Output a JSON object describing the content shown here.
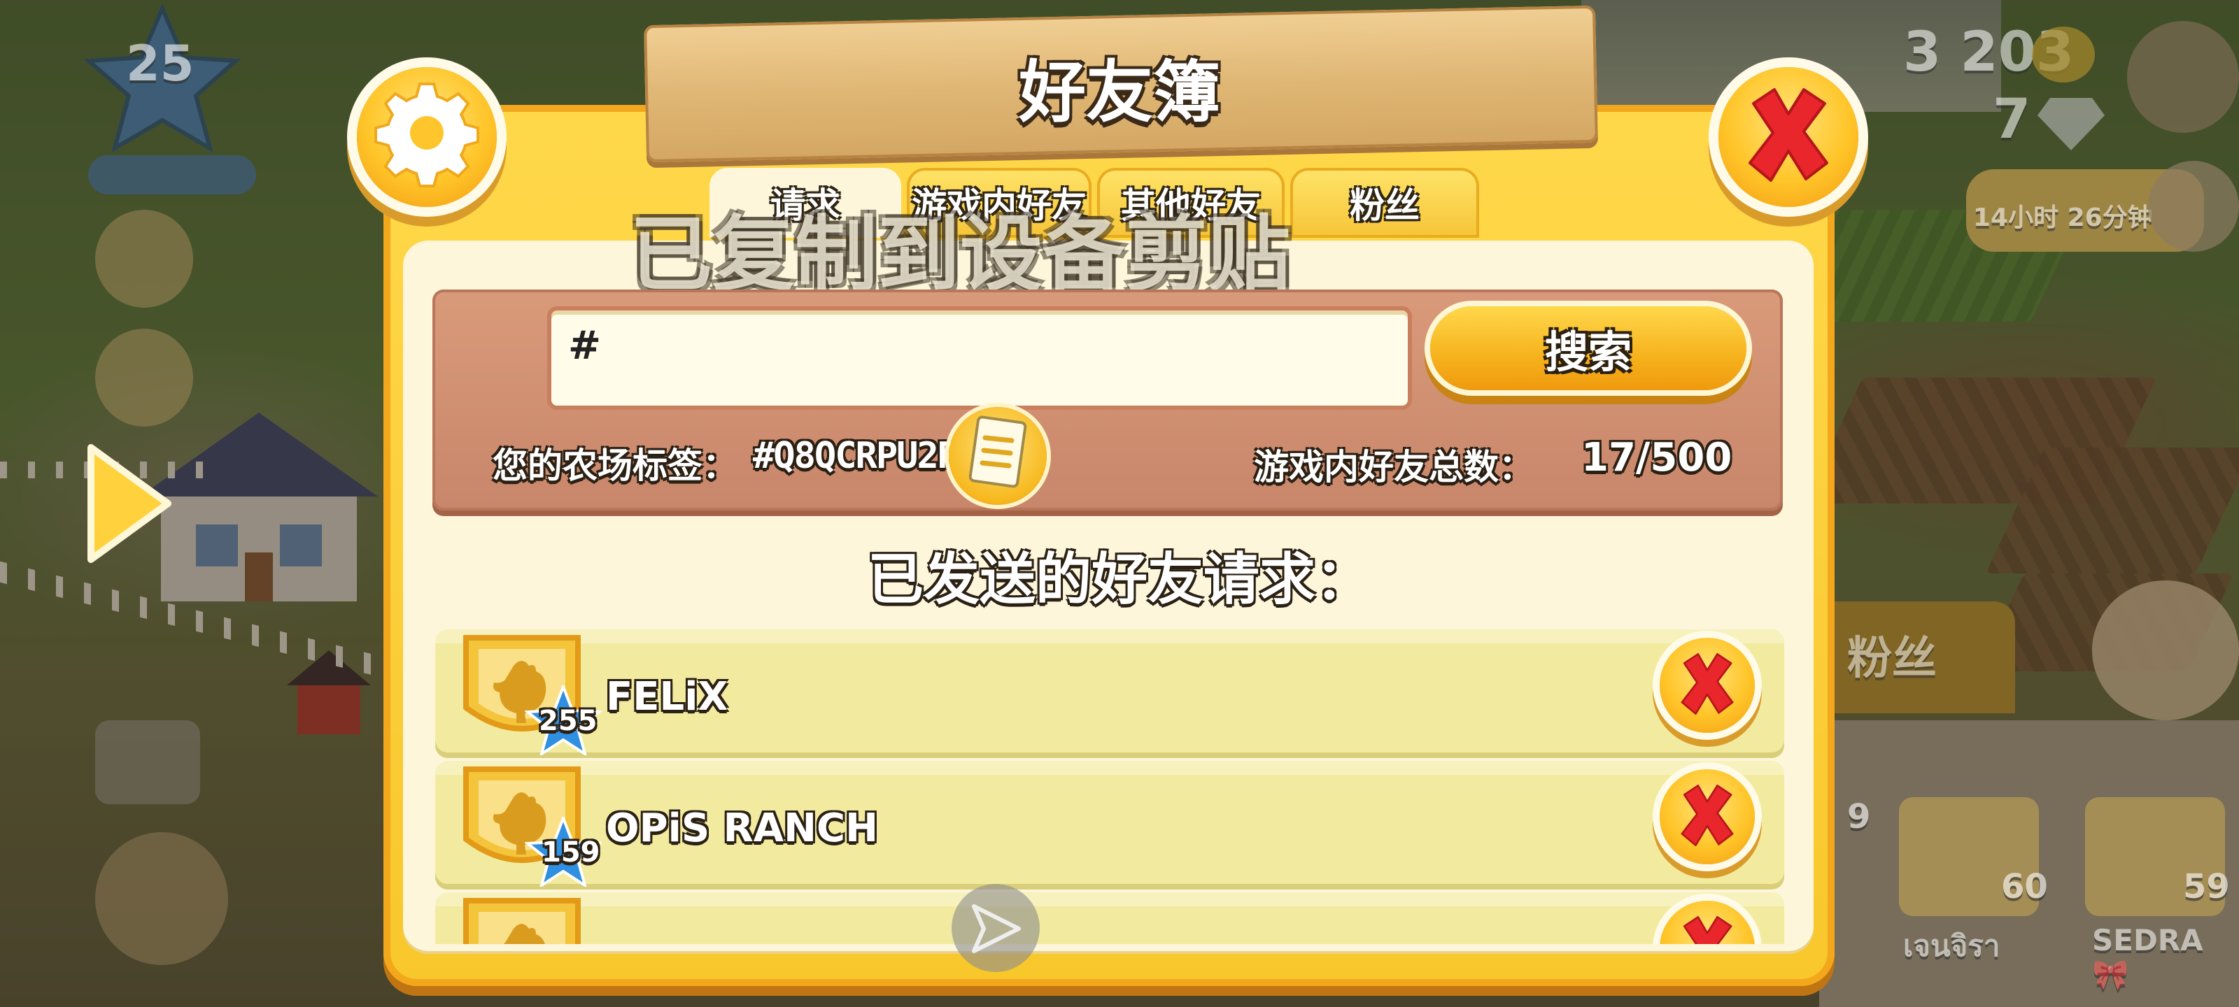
{
  "hud": {
    "level": "25",
    "coins": "3 203",
    "diamonds": "7",
    "timer": "14小时 26分钟",
    "side_tab_label": "粉丝"
  },
  "side_profiles": [
    {
      "level": "9",
      "name": ""
    },
    {
      "level": "60",
      "name": "เจนจิรา"
    },
    {
      "level": "59",
      "name": "SEDRA🎀"
    }
  ],
  "dialog": {
    "title": "好友簿",
    "tabs": [
      {
        "label": "请求",
        "active": true
      },
      {
        "label": "游戏内好友",
        "active": false
      },
      {
        "label": "其他好友",
        "active": false
      },
      {
        "label": "粉丝",
        "active": false
      }
    ],
    "toast": "已复制到设备剪贴板！",
    "search": {
      "value": "#",
      "button_label": "搜索"
    },
    "farm_tag_label": "您的农场标签：",
    "farm_tag_value": "#Q8QCRPU2R",
    "friend_count_label": "游戏内好友总数：",
    "friend_count_value": "17/500",
    "sent_heading": "已发送的好友请求：",
    "requests": [
      {
        "name": "FELiX",
        "level": "255"
      },
      {
        "name": "OPiS RANCH",
        "level": "159"
      },
      {
        "name": "",
        "level": ""
      }
    ]
  },
  "colors": {
    "dialog_frame": "#f8c72c",
    "dialog_inner": "#fdf6da",
    "search_panel": "#c8866a",
    "row_bg": "#f2eb9f",
    "close_red": "#e8262b"
  },
  "icons": {
    "settings": "gear-icon",
    "close": "close-icon",
    "copy": "copy-tag-icon",
    "remove": "remove-request-icon",
    "level_star": "star-icon",
    "avatar": "rooster-badge-icon",
    "play_arrow": "play-arrow-icon"
  }
}
